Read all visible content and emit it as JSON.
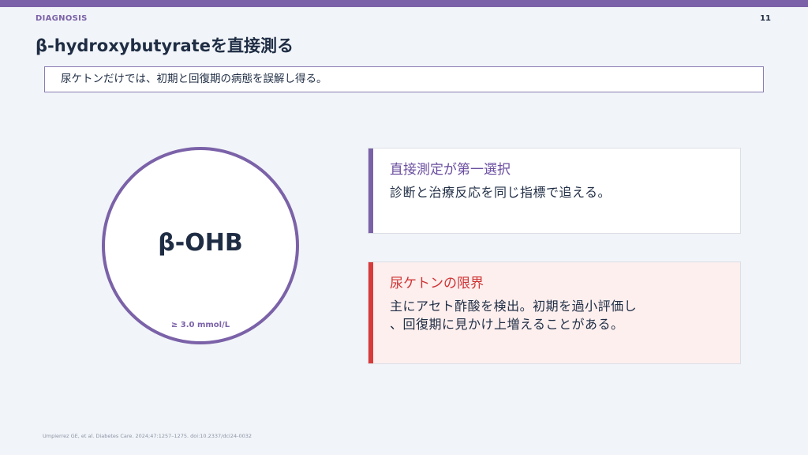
{
  "header": {
    "section": "DIAGNOSIS",
    "page_number": "11",
    "title": "β-hydroxybutyrateを直接測る",
    "subtitle": "尿ケトンだけでは、初期と回復期の病態を誤解し得る。"
  },
  "circle": {
    "label": "β-OHB",
    "threshold": "≥ 3.0 mmol/L"
  },
  "cards": [
    {
      "title": "直接測定が第一選択",
      "body_lines": [
        "診断と治療反応を同じ指標で追える。"
      ]
    },
    {
      "title": "尿ケトンの限界",
      "body_lines": [
        "主にアセト酢酸を検出。初期を過小評価し",
        "、回復期に見かけ上増えることがある。"
      ]
    }
  ],
  "footer": {
    "citation": "Umpierrez GE, et al. Diabetes Care. 2024;47:1257–1275. doi:10.2337/dci24-0032"
  },
  "colors": {
    "accent": "#7b62a8",
    "warning": "#d93a3a",
    "text": "#1f2d44",
    "background": "#f1f4f8"
  }
}
